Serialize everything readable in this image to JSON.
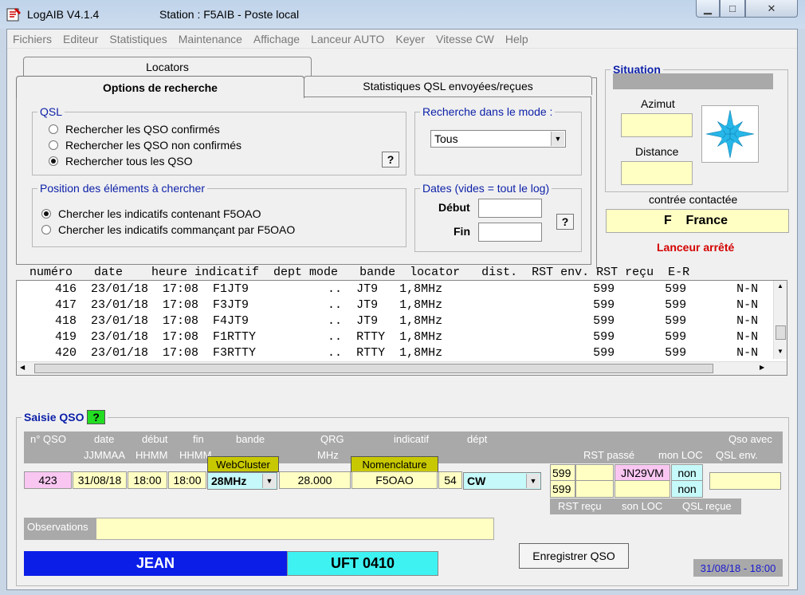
{
  "window": {
    "app_title": "LogAIB  V4.1.4",
    "station_title": "Station : F5AIB - Poste local",
    "controls": {
      "minimize": "▁",
      "maximize": "□",
      "close": "✕"
    }
  },
  "menu": [
    "Fichiers",
    "Editeur",
    "Statistiques",
    "Maintenance",
    "Affichage",
    "Lanceur AUTO",
    "Keyer",
    "Vitesse CW",
    "Help"
  ],
  "tabs": {
    "locators": "Locators",
    "options": "Options de recherche",
    "stats": "Statistiques QSL envoyées/reçues"
  },
  "qsl_group": {
    "legend": "QSL",
    "options": [
      "Rechercher les QSO confirmés",
      "Rechercher les QSO non confirmés",
      "Rechercher tous les QSO"
    ],
    "selected": 2,
    "help": "?"
  },
  "mode_group": {
    "legend": "Recherche dans le mode :",
    "value": "Tous"
  },
  "position_group": {
    "legend": "Position des éléments à chercher",
    "options": [
      "Chercher les indicatifs contenant F5OAO",
      "Chercher les indicatifs commançant par F5OAO"
    ],
    "selected": 0
  },
  "dates_group": {
    "legend": "Dates (vides = tout le log)",
    "start_label": "Début",
    "end_label": "Fin",
    "help": "?"
  },
  "situation": {
    "legend": "Situation",
    "azimut_label": "Azimut",
    "distance_label": "Distance",
    "contree_label": "contrée contactée",
    "contree_value": "F    France",
    "lanceur_status": "Lanceur arrêté",
    "compass_icon": "compass-rose-icon",
    "status_color": "#d40000"
  },
  "log": {
    "header": "numéro   date    heure indicatif  dept mode   bande  locator   dist.  RST env. RST reçu  E-R",
    "rows": [
      "  416  23/01/18  17:08  F1JT9           ..  JT9   1,8MHz                     599       599       N-N",
      "  417  23/01/18  17:08  F3JT9           ..  JT9   1,8MHz                     599       599       N-N",
      "  418  23/01/18  17:08  F4JT9           ..  JT9   1,8MHz                     599       599       N-N",
      "  419  23/01/18  17:08  F1RTTY          ..  RTTY  1,8MHz                     599       599       N-N",
      "  420  23/01/18  17:08  F3RTTY          ..  RTTY  1,8MHz                     599       599       N-N"
    ]
  },
  "saisie": {
    "legend": "Saisie QSO",
    "help": "?",
    "headers": {
      "no_qso": "n° QSO",
      "date": "date",
      "date_fmt": "JJMMAA",
      "debut": "début",
      "debut_fmt": "HHMM",
      "fin": "fin",
      "fin_fmt": "HHMM",
      "bande": "bande",
      "qrg": "QRG",
      "qrg_unit": "MHz",
      "indicatif": "indicatif",
      "dept": "dépt",
      "qso_avec": "Qso avec",
      "rst_passe": "RST passé",
      "mon_loc": "mon LOC",
      "qsl_env": "QSL env.",
      "rst_recu": "RST reçu",
      "son_loc": "son LOC",
      "qsl_recue": "QSL reçue",
      "observations": "Observations"
    },
    "buttons": {
      "webcluster": "WebCluster",
      "nomenclature": "Nomenclature",
      "enregistrer": "Enregistrer QSO"
    },
    "values": {
      "no_qso": "423",
      "date": "31/08/18",
      "debut": "18:00",
      "fin": "18:00",
      "bande": "28MHz",
      "qrg": "28.000",
      "indicatif": "F5OAO",
      "dept": "54",
      "mode": "CW",
      "rst_passe": "599",
      "mon_loc": "JN29VM",
      "qsl_env": "non",
      "rst_recu": "599",
      "qsl_recue": "non"
    },
    "operator_name": "JEAN",
    "operator_locator": "UFT 0410",
    "datetime": "31/08/18 - 18:00",
    "colors": {
      "name_bg": "#0a1ee8",
      "locator_bg": "#3ef2f2",
      "pink": "#f9c6f2",
      "yellow": "#ffffc4"
    }
  }
}
